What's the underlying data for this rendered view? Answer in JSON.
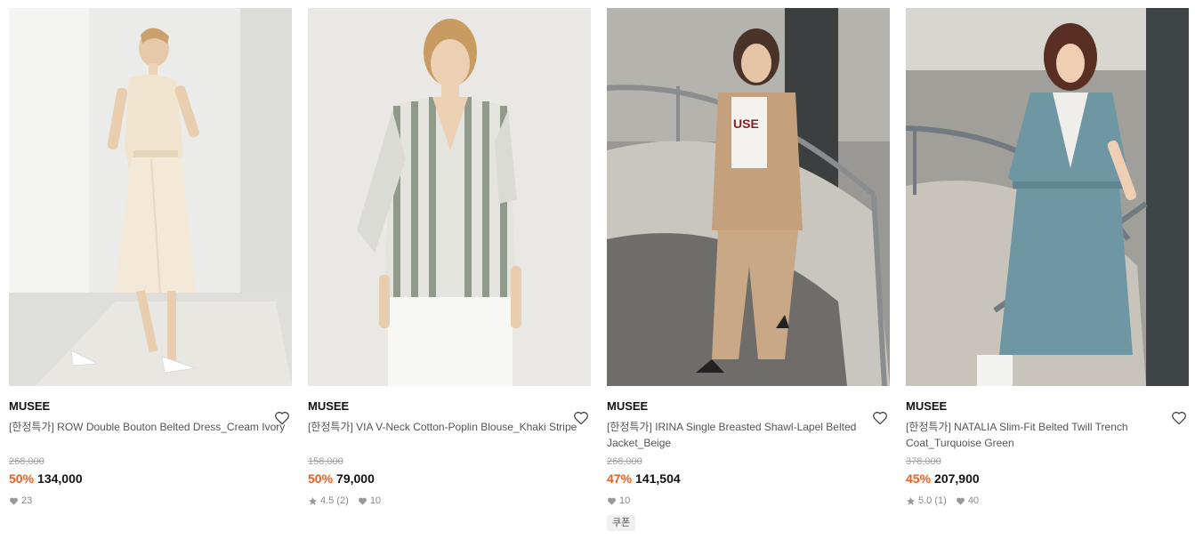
{
  "products": [
    {
      "brand": "MUSEE",
      "title": "[한정특가] ROW Double Bouton Belted Dress_Cream Ivory",
      "original_price": "268,000",
      "discount": "50%",
      "price": "134,000",
      "likes": "23",
      "image_desc": "cream-belted-dress-photo"
    },
    {
      "brand": "MUSEE",
      "title": "[한정특가] VIA V-Neck Cotton-Poplin Blouse_Khaki Stripe",
      "original_price": "158,000",
      "discount": "50%",
      "price": "79,000",
      "rating": "4.5",
      "rating_count": "(2)",
      "likes": "10",
      "image_desc": "striped-blouse-photo"
    },
    {
      "brand": "MUSEE",
      "title": "[한정특가] IRINA Single Breasted Shawl-Lapel Belted Jacket_Beige",
      "original_price": "268,000",
      "discount": "47%",
      "price": "141,504",
      "likes": "10",
      "coupon": "쿠폰",
      "image_desc": "beige-jacket-photo"
    },
    {
      "brand": "MUSEE",
      "title": "[한정특가] NATALIA Slim-Fit Belted Twill Trench Coat_Turquoise Green",
      "original_price": "378,000",
      "discount": "45%",
      "price": "207,900",
      "rating": "5.0",
      "rating_count": "(1)",
      "likes": "40",
      "image_desc": "turquoise-trench-coat-photo"
    }
  ],
  "colors": {
    "discount": "#f25c1a",
    "brand_text": "#111111",
    "muted": "#888888"
  }
}
